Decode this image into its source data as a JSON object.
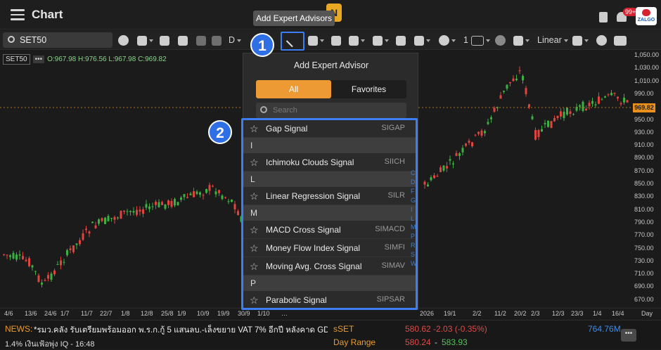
{
  "app": {
    "title": "Chart",
    "logo_partial": "N"
  },
  "tooltip": "Add Expert Advisors",
  "top_right": {
    "badge": "99+",
    "zalgo": "ZALGO"
  },
  "toolbar": {
    "symbol": "SET50",
    "interval": "D",
    "line_width": "1",
    "scale": "Linear"
  },
  "info": {
    "symbol": "SET50",
    "dots": "•••",
    "ohlc": "O:967.98 H:976.56 L:967.98 C:969.82"
  },
  "price_axis": [
    "1,050.00",
    "1,030.00",
    "1,010.00",
    "990.00",
    "970.00",
    "950.00",
    "930.00",
    "910.00",
    "890.00",
    "870.00",
    "850.00",
    "830.00",
    "810.00",
    "790.00",
    "770.00",
    "750.00",
    "730.00",
    "710.00",
    "690.00",
    "670.00"
  ],
  "last_price": "969.82",
  "date_axis": [
    "4/6",
    "13/6",
    "24/6",
    "1/7",
    "11/7",
    "22/7",
    "1/8",
    "12/8",
    "25/8",
    "1/9",
    "10/9",
    "19/9",
    "30/9",
    "1/10",
    "…",
    "2026",
    "19/1",
    "2/2",
    "11/2",
    "20/2",
    "2/3",
    "12/3",
    "23/3",
    "1/4",
    "16/4",
    "Day"
  ],
  "dialog": {
    "title": "Add Expert Advisor",
    "tab_all": "All",
    "tab_favorites": "Favorites",
    "search_placeholder": "Search"
  },
  "list": [
    {
      "type": "item",
      "name": "Gap Signal",
      "code": "SIGAP"
    },
    {
      "type": "header",
      "label": "I"
    },
    {
      "type": "item",
      "name": "Ichimoku Clouds Signal",
      "code": "SIICH"
    },
    {
      "type": "header",
      "label": "L"
    },
    {
      "type": "item",
      "name": "Linear Regression Signal",
      "code": "SILR"
    },
    {
      "type": "header",
      "label": "M"
    },
    {
      "type": "item",
      "name": "MACD Cross Signal",
      "code": "SIMACD"
    },
    {
      "type": "item",
      "name": "Money Flow Index Signal",
      "code": "SIMFI"
    },
    {
      "type": "item",
      "name": "Moving Avg. Cross Signal",
      "code": "SIMAV"
    },
    {
      "type": "header",
      "label": "P"
    },
    {
      "type": "item",
      "name": "Parabolic Signal",
      "code": "SIPSAR"
    }
  ],
  "alpha_index": [
    "C",
    "D",
    "F",
    "G",
    "I",
    "L",
    "M",
    "P",
    "R",
    "S",
    "W"
  ],
  "callouts": [
    "1",
    "2"
  ],
  "news": {
    "label": "NEWS:",
    "text": "*รมว.คลัง รับเตรียมพร้อมออก พ.ร.ก.กู้ 5 แสนลบ.-เล็งขยาย VAT 7% อีกปี หลังคาด GDP โตแค่",
    "line2": "1.4% เงินเฟ้อพุ่ง  IQ - 16:48"
  },
  "quote": {
    "symbol": "sSET",
    "price": "580.62 -2.03 (-0.35%)",
    "volume": "764.76M",
    "range_label": "Day Range",
    "low": "580.24",
    "sep": "-",
    "high": "583.93",
    "more": "•••"
  },
  "colors": {
    "accent": "#ee9a34",
    "highlight": "#3d7ff2",
    "up": "#3cb043",
    "down": "#e0443e"
  }
}
